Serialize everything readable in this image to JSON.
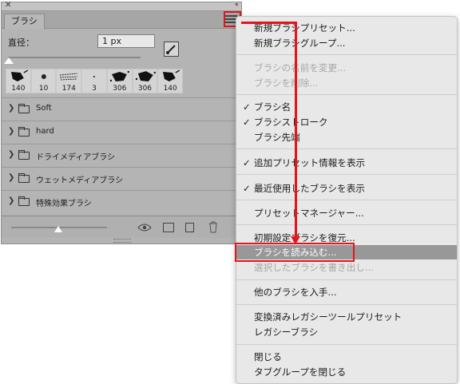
{
  "panel": {
    "close_glyph": "✕",
    "collapse_glyph": "‹‹",
    "tab_label": "ブラシ",
    "size_label": "直径：",
    "size_value": "1 px",
    "presets": [
      {
        "size": "140",
        "icon": "leaf-splatter-icon"
      },
      {
        "size": "10",
        "icon": "soft-round-icon"
      },
      {
        "size": "174",
        "icon": "dry-brush-icon"
      },
      {
        "size": "3",
        "icon": "hard-round-icon"
      },
      {
        "size": "306",
        "icon": "splatter-icon"
      },
      {
        "size": "306",
        "icon": "splatter-icon"
      },
      {
        "size": "140",
        "icon": "leaf-splatter-icon"
      }
    ],
    "folders": [
      "Soft",
      "hard",
      "ドライメディアブラシ",
      "ウェットメディアブラシ",
      "特殊効果ブラシ"
    ],
    "bottom_icons": [
      "visibility-icon",
      "folder-icon",
      "new-brush-icon",
      "trash-icon"
    ]
  },
  "menu": {
    "check_glyph": "✓",
    "items": [
      {
        "label": "新規ブラシプリセット...",
        "enabled": true,
        "checked": false
      },
      {
        "label": "新規ブラシグループ...",
        "enabled": true,
        "checked": false
      },
      {
        "label": "ブラシの名前を変更...",
        "enabled": false,
        "checked": false
      },
      {
        "label": "ブラシを削除...",
        "enabled": false,
        "checked": false
      },
      {
        "label": "ブラシ名",
        "enabled": true,
        "checked": true
      },
      {
        "label": "ブラシストローク",
        "enabled": true,
        "checked": true
      },
      {
        "label": "ブラシ先端",
        "enabled": true,
        "checked": false
      },
      {
        "label": "追加プリセット情報を表示",
        "enabled": true,
        "checked": true
      },
      {
        "label": "最近使用したブラシを表示",
        "enabled": true,
        "checked": true
      },
      {
        "label": "プリセットマネージャー...",
        "enabled": true,
        "checked": false
      },
      {
        "label": "初期設定ブラシを復元...",
        "enabled": true,
        "checked": false
      },
      {
        "label": "ブラシを読み込む...",
        "enabled": true,
        "checked": false,
        "highlighted": true
      },
      {
        "label": "選択したブラシを書き出し...",
        "enabled": false,
        "checked": false
      },
      {
        "label": "他のブラシを入手...",
        "enabled": true,
        "checked": false
      },
      {
        "label": "変換済みレガシーツールプリセット",
        "enabled": true,
        "checked": false
      },
      {
        "label": "レガシーブラシ",
        "enabled": true,
        "checked": false
      },
      {
        "label": "閉じる",
        "enabled": true,
        "checked": false
      },
      {
        "label": "タブグループを閉じる",
        "enabled": true,
        "checked": false
      }
    ]
  },
  "colors": {
    "annotation_red": "#e3151b",
    "panel_bg": "#b4b4b4",
    "menu_bg": "#e8e8e8",
    "menu_highlight": "#989898"
  }
}
